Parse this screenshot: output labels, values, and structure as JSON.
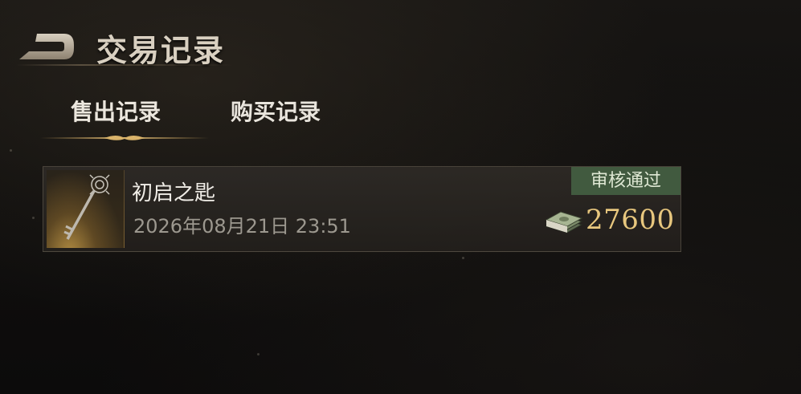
{
  "header": {
    "title": "交易记录",
    "back_icon": "back-arrow-icon"
  },
  "tabs": [
    {
      "label": "售出记录",
      "active": true
    },
    {
      "label": "购买记录",
      "active": false
    }
  ],
  "records": [
    {
      "item_name": "初启之匙",
      "item_icon": "key-icon",
      "date": "2026年08月21日 23:51",
      "status": "审核通过",
      "currency_icon": "money-stack-icon",
      "price": "27600"
    }
  ],
  "colors": {
    "background": "#100f0e",
    "accent_gold": "#e8c77e",
    "status_green": "#415a3f",
    "tab_indicator": "#c9a25d"
  }
}
